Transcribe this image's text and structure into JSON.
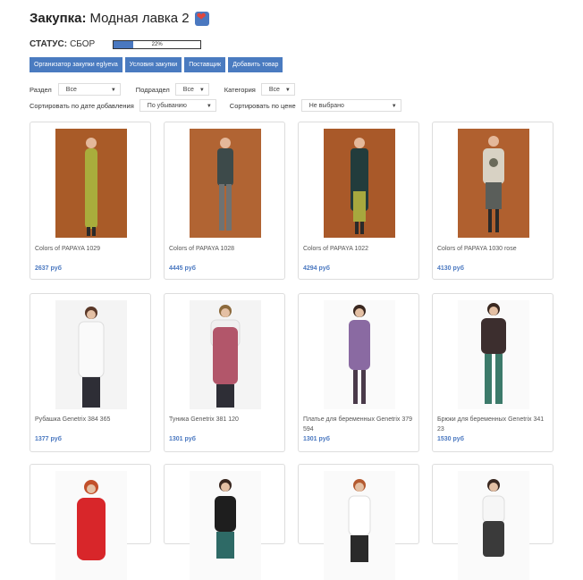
{
  "title": {
    "label": "Закупка:",
    "name": "Модная лавка 2"
  },
  "status": {
    "label": "СТАТУС:",
    "value": "СБОР",
    "progress_text": "22%",
    "progress": 22
  },
  "buttons": [
    "Организатор закупки eglyeva",
    "Условия закупки",
    "Поставщик",
    "Добавить товар"
  ],
  "filters": {
    "section_label": "Раздел",
    "section_value": "Все",
    "subsection_label": "Подраздел",
    "subsection_value": "Все",
    "category_label": "Категория",
    "category_value": "Все",
    "sort_date_label": "Сортировать по дате добавления",
    "sort_date_value": "По убыванию",
    "sort_price_label": "Сортировать по цене",
    "sort_price_value": "Не выбрано"
  },
  "products": [
    {
      "name": "Colors of PAPAYA 1029",
      "price": "2637 руб"
    },
    {
      "name": "Colors of PAPAYA 1028",
      "price": "4445 руб"
    },
    {
      "name": "Colors of PAPAYA 1022",
      "price": "4294 руб"
    },
    {
      "name": "Colors of PAPAYA 1030 rose",
      "price": "4130 руб"
    },
    {
      "name": "Рубашка Genetrix 384 365",
      "price": "1377 руб"
    },
    {
      "name": "Туника Genetrix 381 120",
      "price": "1301 руб"
    },
    {
      "name": "Платье для беременных Genetrix 379 594",
      "price": "1301 руб"
    },
    {
      "name": "Брюки для беременных Genetrix 341 23",
      "price": "1530 руб"
    },
    {
      "name": "",
      "price": ""
    },
    {
      "name": "",
      "price": ""
    },
    {
      "name": "",
      "price": ""
    },
    {
      "name": "",
      "price": ""
    }
  ],
  "colors": {
    "accent": "#4a7bc0",
    "price": "#4a78c0"
  }
}
